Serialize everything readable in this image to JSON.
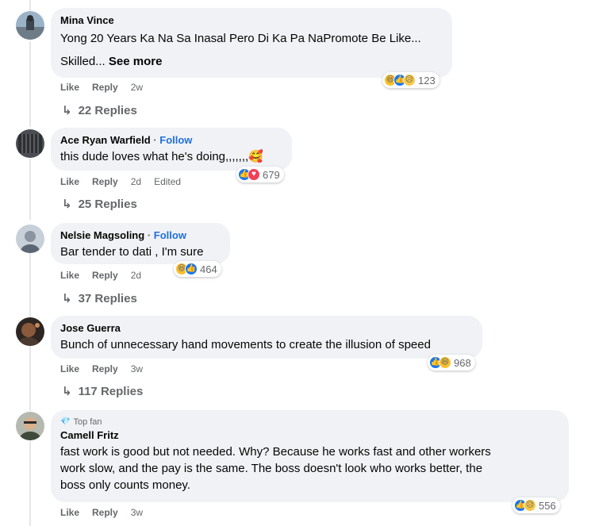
{
  "comments": [
    {
      "author": "Mina Vince",
      "follow": "",
      "text_lines": [
        "Yong 20 Years Ka Na Sa Inasal Pero Di Ka Pa NaPromote Be Like...",
        "Skilled..."
      ],
      "see_more": "See more",
      "like": "Like",
      "reply": "Reply",
      "time": "2w",
      "edited": "",
      "reactions": [
        "haha-icon",
        "like-icon",
        "sad-icon"
      ],
      "reaction_count": "123",
      "replies": "22 Replies"
    },
    {
      "author": "Ace Ryan Warfield",
      "follow": "Follow",
      "text": "this dude loves what he's doing,,,,,,,🥰",
      "like": "Like",
      "reply": "Reply",
      "time": "2d",
      "edited": "Edited",
      "reactions": [
        "like-icon",
        "love-icon"
      ],
      "reaction_count": "679",
      "replies": "25 Replies"
    },
    {
      "author": "Nelsie Magsoling",
      "follow": "Follow",
      "text": "Bar tender to dati , I'm sure",
      "like": "Like",
      "reply": "Reply",
      "time": "2d",
      "reactions": [
        "haha-icon",
        "like-icon"
      ],
      "reaction_count": "464",
      "replies": "37 Replies"
    },
    {
      "author": "Jose Guerra",
      "text": "Bunch of unnecessary hand movements to create the illusion of speed",
      "like": "Like",
      "reply": "Reply",
      "time": "3w",
      "reactions": [
        "like-icon",
        "haha-icon"
      ],
      "reaction_count": "968",
      "replies": "117 Replies"
    },
    {
      "badge": "Top fan",
      "author": "Camell Fritz",
      "text_lines": [
        "fast work is good but not needed. Why? Because he works fast and other workers",
        "work slow, and the pay is the same. The boss doesn't look who works better, the",
        "boss only counts money."
      ],
      "like": "Like",
      "reply": "Reply",
      "time": "3w",
      "reactions": [
        "like-icon",
        "sad-icon"
      ],
      "reaction_count": "556"
    }
  ],
  "colors": {
    "bubble": "#f0f2f5",
    "link": "#216fdb",
    "meta": "#65676b",
    "like_blue": "#1877f2",
    "love_red": "#f33e58",
    "haha_yellow": "#fbc02d"
  },
  "glyphs": {
    "haha": "😆",
    "like": "👍",
    "sad": "😥",
    "love": "♥",
    "dot": "·",
    "diamond": "💎"
  }
}
